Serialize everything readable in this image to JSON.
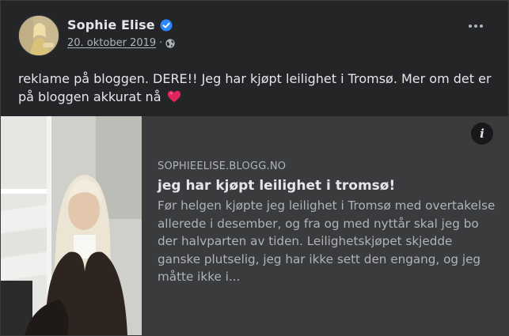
{
  "post": {
    "author": "Sophie Elise",
    "date": "20. oktober 2019",
    "separator": "·",
    "text": "reklame på bloggen. DERE!! Jeg har kjøpt leilighet i Tromsø. Mer om det er på bloggen akkurat nå",
    "icons": {
      "verified": "verified-badge-icon",
      "privacy": "globe-icon",
      "emoji": "red-heart-icon",
      "menu": "more-options-icon"
    }
  },
  "link": {
    "domain": "SOPHIEELISE.BLOGG.NO",
    "title": "jeg har kjøpt leilighet i tromsø!",
    "description": "Før helgen kjøpte jeg leilighet i Tromsø med overtakelse allerede i desember, og fra og med nyttår skal jeg bo der halvparten av tiden. Leilighetskjøpet skjedde ganske plutselig, jeg har ikke sett den engang, og jeg måtte ikke i...",
    "info_label": "i"
  },
  "colors": {
    "card_background": "#242526",
    "preview_background": "#3a3b3c",
    "primary_text": "#e4e6eb",
    "secondary_text": "#b0b3b8",
    "verified_blue": "#2d88ff",
    "heart_red": "#e0245e"
  }
}
